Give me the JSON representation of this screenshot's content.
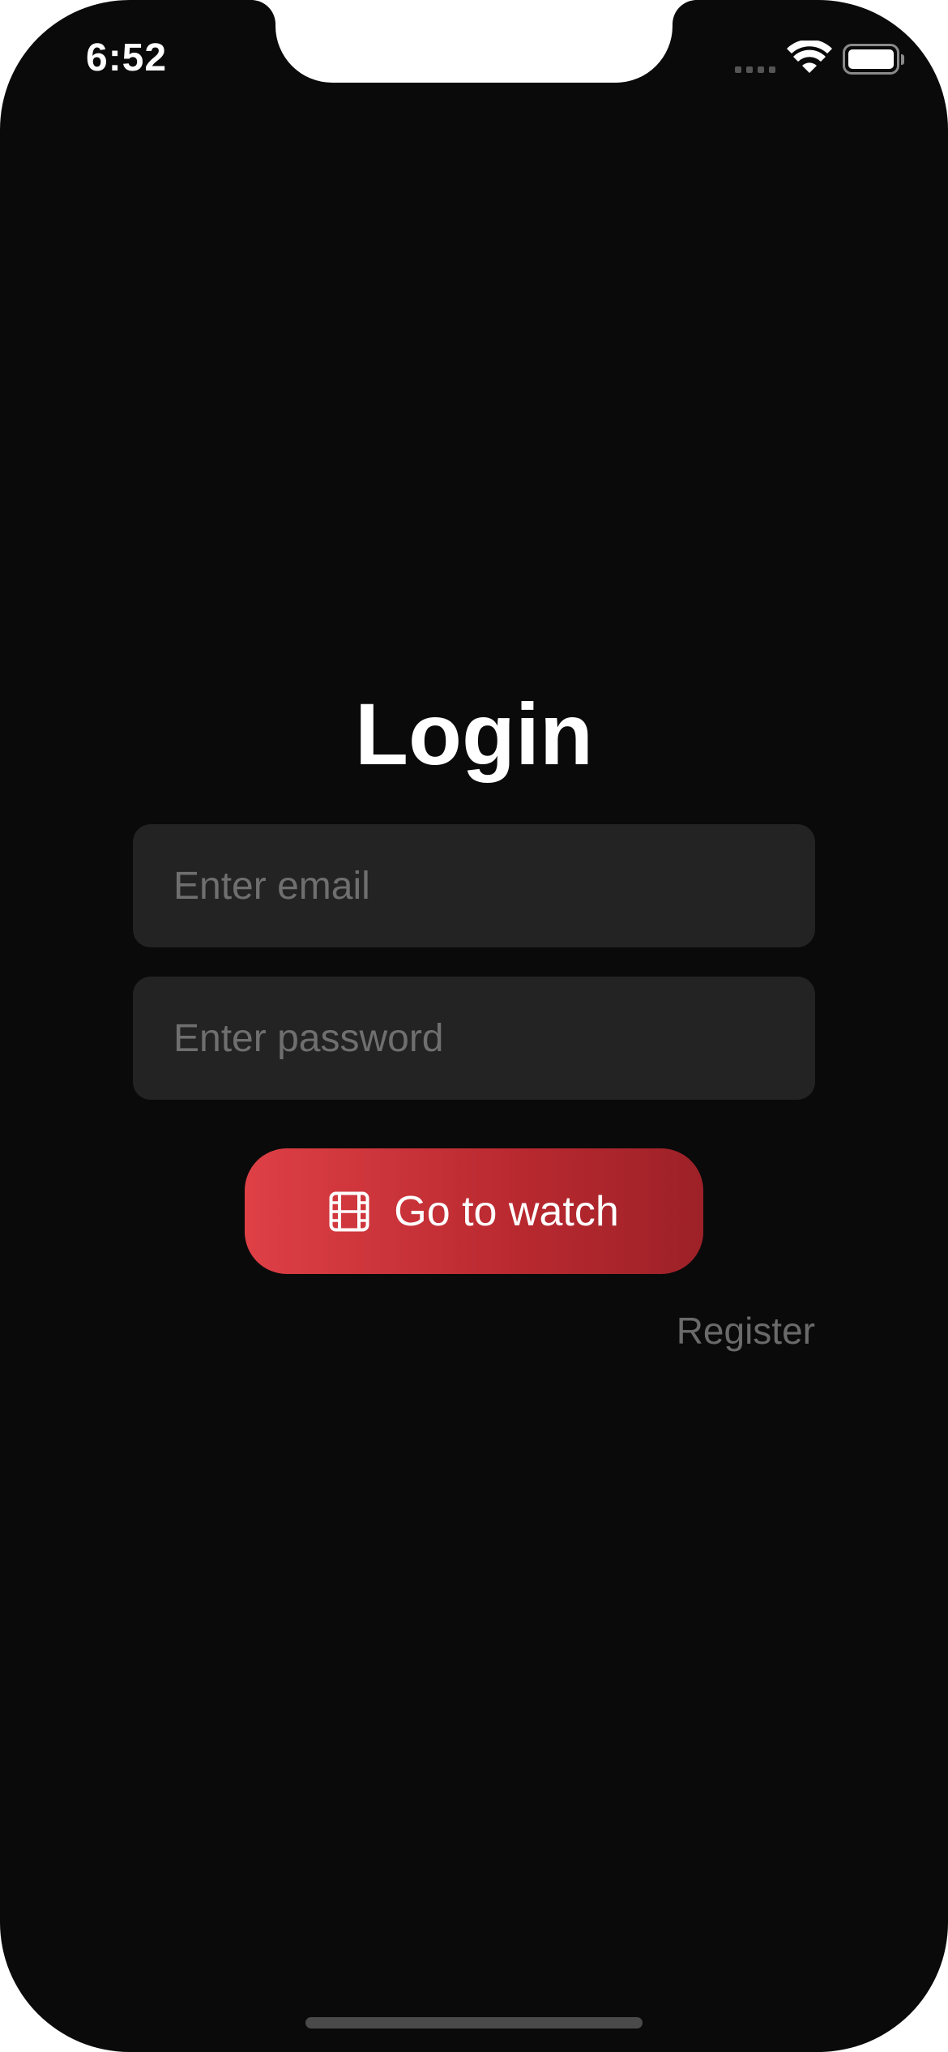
{
  "status_bar": {
    "time": "6:52",
    "wifi_icon": "wifi-icon",
    "battery_icon": "battery-icon",
    "battery_level": 1.0
  },
  "login": {
    "title": "Login",
    "email_placeholder": "Enter email",
    "email_value": "",
    "password_placeholder": "Enter password",
    "password_value": "",
    "watch_button": {
      "label": "Go to watch",
      "icon": "film-icon"
    },
    "register_label": "Register"
  },
  "colors": {
    "background": "#0a0a0a",
    "field_background": "#232323",
    "accent_start": "#de4046",
    "accent_end": "#9d2128",
    "muted_text": "#6a6a6a"
  }
}
